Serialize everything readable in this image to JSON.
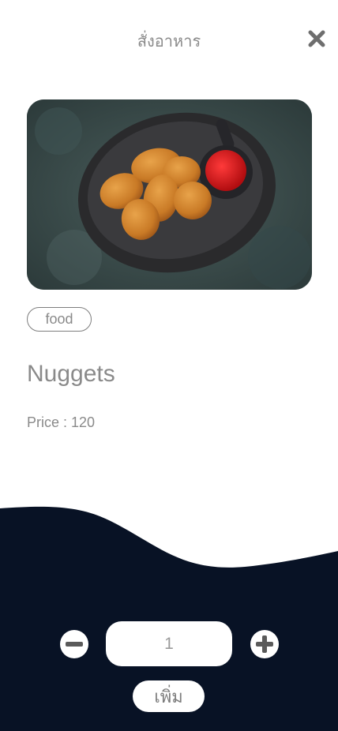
{
  "header": {
    "title": "สั่งอาหาร",
    "close_icon": "close-icon"
  },
  "item": {
    "image_icon": "food-photo",
    "category": "food",
    "name": "Nuggets",
    "price_label": "Price : 120"
  },
  "order": {
    "quantity": "1",
    "minus_icon": "minus-icon",
    "plus_icon": "plus-icon",
    "add_label": "เพิ่ม"
  },
  "colors": {
    "panel": "#081225",
    "text_gray": "#8a8a8a",
    "icon_gray": "#5a5a5a"
  }
}
